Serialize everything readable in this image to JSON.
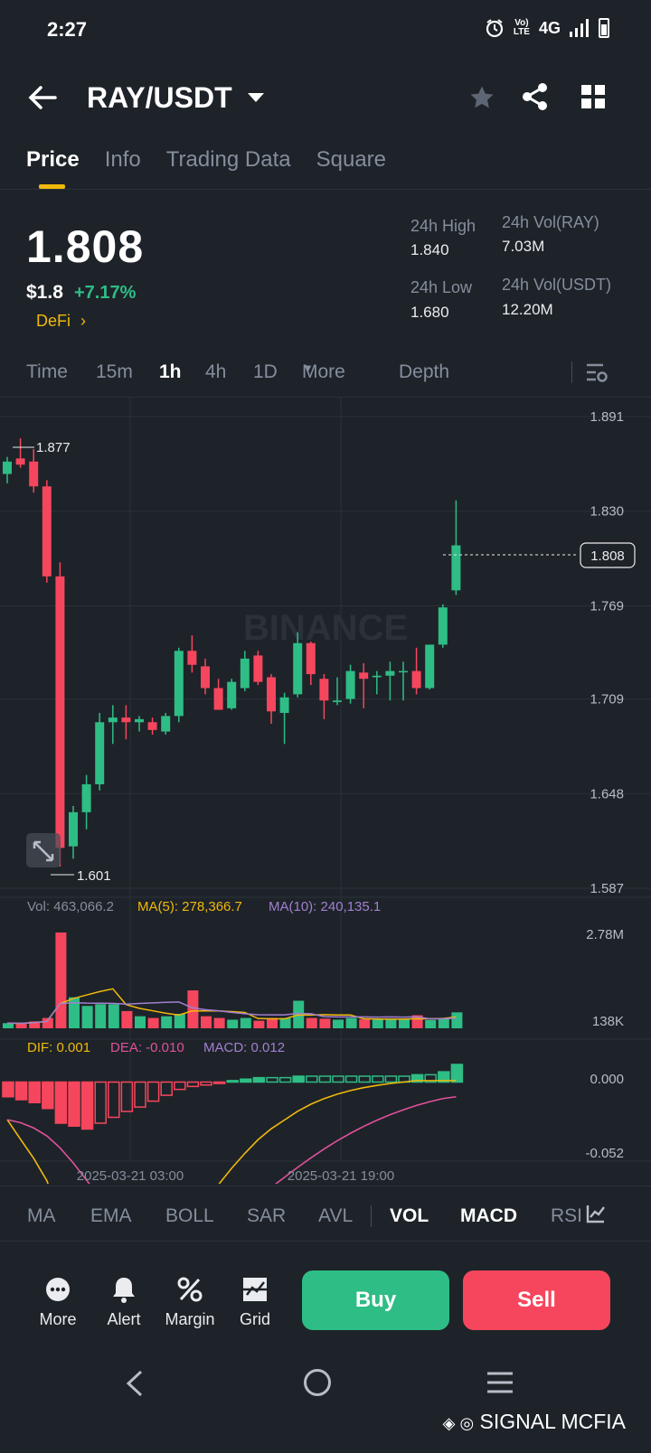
{
  "status_bar": {
    "time": "2:27",
    "network": "4G"
  },
  "header": {
    "pair": "RAY/USDT"
  },
  "tabs": [
    {
      "label": "Price",
      "active": true
    },
    {
      "label": "Info",
      "active": false
    },
    {
      "label": "Trading Data",
      "active": false
    },
    {
      "label": "Square",
      "active": false
    }
  ],
  "ticker": {
    "last_price": "1.808",
    "usd_price": "$1.8",
    "change_pct": "+7.17%",
    "sector": "DeFi",
    "high_24h_label": "24h High",
    "high_24h": "1.840",
    "low_24h_label": "24h Low",
    "low_24h": "1.680",
    "vol_ray_label": "24h Vol(RAY)",
    "vol_ray": "7.03M",
    "vol_usdt_label": "24h Vol(USDT)",
    "vol_usdt": "12.20M"
  },
  "intervals": {
    "items": [
      "Time",
      "15m",
      "1h",
      "4h",
      "1D",
      "More",
      "Depth"
    ],
    "selected": "1h"
  },
  "chart": {
    "watermark": "BINANCE",
    "current_price_tag": "1.808",
    "max_label": "1.877",
    "min_label": "1.601",
    "volume_legend": {
      "vol": "Vol: 463,066.2",
      "ma5": "MA(5): 278,366.7",
      "ma10": "MA(10): 240,135.1"
    },
    "volume_axis": [
      "2.78M",
      "138K"
    ],
    "macd_legend": {
      "dif": "DIF: 0.001",
      "dea": "DEA: -0.010",
      "macd": "MACD: 0.012"
    },
    "macd_axis": [
      "0.000",
      "-0.052"
    ],
    "time_labels": [
      "2025-03-21 03:00",
      "2025-03-21 19:00"
    ]
  },
  "chart_data": {
    "type": "candlestick",
    "interval": "1h",
    "ylim": [
      1.587,
      1.891
    ],
    "y_ticks": [
      1.891,
      1.83,
      1.769,
      1.709,
      1.648,
      1.587
    ],
    "candles": [
      {
        "o": 1.854,
        "h": 1.865,
        "l": 1.848,
        "c": 1.862
      },
      {
        "o": 1.864,
        "h": 1.877,
        "l": 1.858,
        "c": 1.86
      },
      {
        "o": 1.862,
        "h": 1.87,
        "l": 1.842,
        "c": 1.846
      },
      {
        "o": 1.846,
        "h": 1.85,
        "l": 1.784,
        "c": 1.788
      },
      {
        "o": 1.788,
        "h": 1.797,
        "l": 1.601,
        "c": 1.613
      },
      {
        "o": 1.614,
        "h": 1.64,
        "l": 1.606,
        "c": 1.636
      },
      {
        "o": 1.636,
        "h": 1.66,
        "l": 1.625,
        "c": 1.654
      },
      {
        "o": 1.654,
        "h": 1.7,
        "l": 1.65,
        "c": 1.694
      },
      {
        "o": 1.694,
        "h": 1.705,
        "l": 1.68,
        "c": 1.697
      },
      {
        "o": 1.697,
        "h": 1.705,
        "l": 1.683,
        "c": 1.694
      },
      {
        "o": 1.694,
        "h": 1.698,
        "l": 1.688,
        "c": 1.696
      },
      {
        "o": 1.694,
        "h": 1.697,
        "l": 1.686,
        "c": 1.689
      },
      {
        "o": 1.688,
        "h": 1.7,
        "l": 1.686,
        "c": 1.698
      },
      {
        "o": 1.698,
        "h": 1.742,
        "l": 1.694,
        "c": 1.74
      },
      {
        "o": 1.74,
        "h": 1.75,
        "l": 1.726,
        "c": 1.731
      },
      {
        "o": 1.73,
        "h": 1.735,
        "l": 1.712,
        "c": 1.716
      },
      {
        "o": 1.716,
        "h": 1.722,
        "l": 1.708,
        "c": 1.702
      },
      {
        "o": 1.703,
        "h": 1.722,
        "l": 1.702,
        "c": 1.72
      },
      {
        "o": 1.716,
        "h": 1.74,
        "l": 1.714,
        "c": 1.735
      },
      {
        "o": 1.737,
        "h": 1.74,
        "l": 1.718,
        "c": 1.72
      },
      {
        "o": 1.723,
        "h": 1.725,
        "l": 1.693,
        "c": 1.701
      },
      {
        "o": 1.7,
        "h": 1.713,
        "l": 1.68,
        "c": 1.71
      },
      {
        "o": 1.712,
        "h": 1.752,
        "l": 1.71,
        "c": 1.745
      },
      {
        "o": 1.745,
        "h": 1.746,
        "l": 1.718,
        "c": 1.725
      },
      {
        "o": 1.722,
        "h": 1.725,
        "l": 1.696,
        "c": 1.708
      },
      {
        "o": 1.707,
        "h": 1.723,
        "l": 1.705,
        "c": 1.708
      },
      {
        "o": 1.709,
        "h": 1.731,
        "l": 1.706,
        "c": 1.727
      },
      {
        "o": 1.726,
        "h": 1.732,
        "l": 1.703,
        "c": 1.722
      },
      {
        "o": 1.723,
        "h": 1.727,
        "l": 1.712,
        "c": 1.724
      },
      {
        "o": 1.724,
        "h": 1.733,
        "l": 1.708,
        "c": 1.727
      },
      {
        "o": 1.727,
        "h": 1.733,
        "l": 1.708,
        "c": 1.727
      },
      {
        "o": 1.727,
        "h": 1.742,
        "l": 1.712,
        "c": 1.716
      },
      {
        "o": 1.716,
        "h": 1.742,
        "l": 1.715,
        "c": 1.744
      },
      {
        "o": 1.744,
        "h": 1.77,
        "l": 1.742,
        "c": 1.768
      },
      {
        "o": 1.779,
        "h": 1.837,
        "l": 1.776,
        "c": 1.808
      }
    ],
    "volume_ylim": [
      138000,
      2780000
    ],
    "volume": [
      150000,
      140000,
      200000,
      300000,
      2780000,
      900000,
      650000,
      700000,
      700000,
      500000,
      350000,
      300000,
      350000,
      420000,
      1100000,
      350000,
      300000,
      250000,
      300000,
      220000,
      300000,
      300000,
      800000,
      300000,
      280000,
      250000,
      300000,
      260000,
      250000,
      260000,
      250000,
      380000,
      240000,
      300000,
      463066
    ],
    "macd_ylim": [
      -0.052,
      0.012
    ],
    "macd_hist": [
      -0.01,
      -0.012,
      -0.014,
      -0.018,
      -0.028,
      -0.03,
      -0.032,
      -0.028,
      -0.024,
      -0.02,
      -0.017,
      -0.013,
      -0.009,
      -0.005,
      -0.003,
      -0.002,
      -0.001,
      0.001,
      0.002,
      0.003,
      0.003,
      0.003,
      0.004,
      0.004,
      0.004,
      0.004,
      0.004,
      0.004,
      0.004,
      0.004,
      0.004,
      0.005,
      0.005,
      0.007,
      0.012
    ]
  },
  "indicators": {
    "items": [
      "MA",
      "EMA",
      "BOLL",
      "SAR",
      "AVL",
      "VOL",
      "MACD",
      "RSI"
    ],
    "active": [
      "VOL",
      "MACD"
    ]
  },
  "actions": [
    {
      "label": "More",
      "icon": "more-dots-icon"
    },
    {
      "label": "Alert",
      "icon": "bell-icon"
    },
    {
      "label": "Margin",
      "icon": "percent-icon"
    },
    {
      "label": "Grid",
      "icon": "grid-bot-icon"
    }
  ],
  "buttons": {
    "buy": "Buy",
    "sell": "Sell"
  },
  "watermark_text": "SIGNAL MCFIA",
  "colors": {
    "up": "#2ebd85",
    "down": "#f6465d",
    "accent": "#f0b90b",
    "bg": "#1e2329",
    "muted": "#848e9c"
  }
}
